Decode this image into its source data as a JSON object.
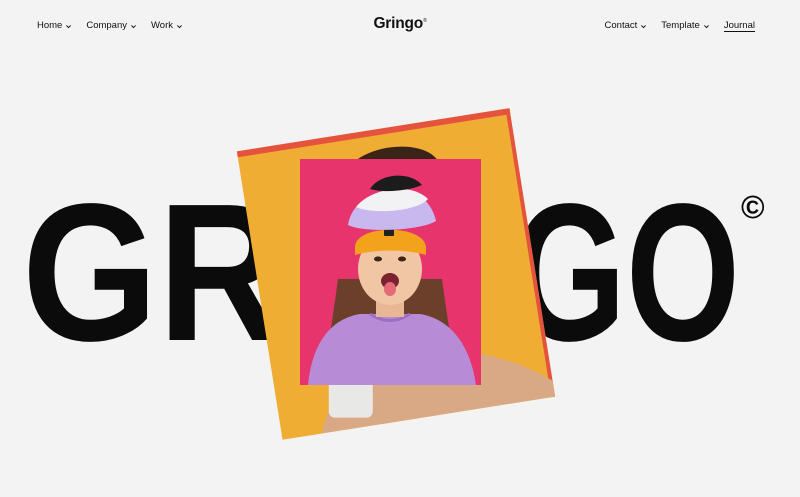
{
  "nav": {
    "left_items": [
      {
        "label": "Home",
        "has_dropdown": true
      },
      {
        "label": "Company",
        "has_dropdown": true
      },
      {
        "label": "Work",
        "has_dropdown": true
      }
    ],
    "logo": "Gringo",
    "logo_mark": "®",
    "right_items": [
      {
        "label": "Contact",
        "has_dropdown": true
      },
      {
        "label": "Template",
        "has_dropdown": true
      },
      {
        "label": "Journal",
        "has_dropdown": false
      }
    ]
  },
  "hero": {
    "word_left": "GR",
    "word_right": "GO",
    "copyright_symbol": "©"
  },
  "colors": {
    "background": "#f3f3f3",
    "text": "#111111",
    "photo_back_orange": "#f0ad33",
    "photo_back_red": "#e5533f",
    "photo_front_pink": "#e7346d",
    "beanie_yellow": "#f2a21b",
    "hat_lavender": "#c9b8ee",
    "sweater_lilac": "#b78bd6"
  }
}
